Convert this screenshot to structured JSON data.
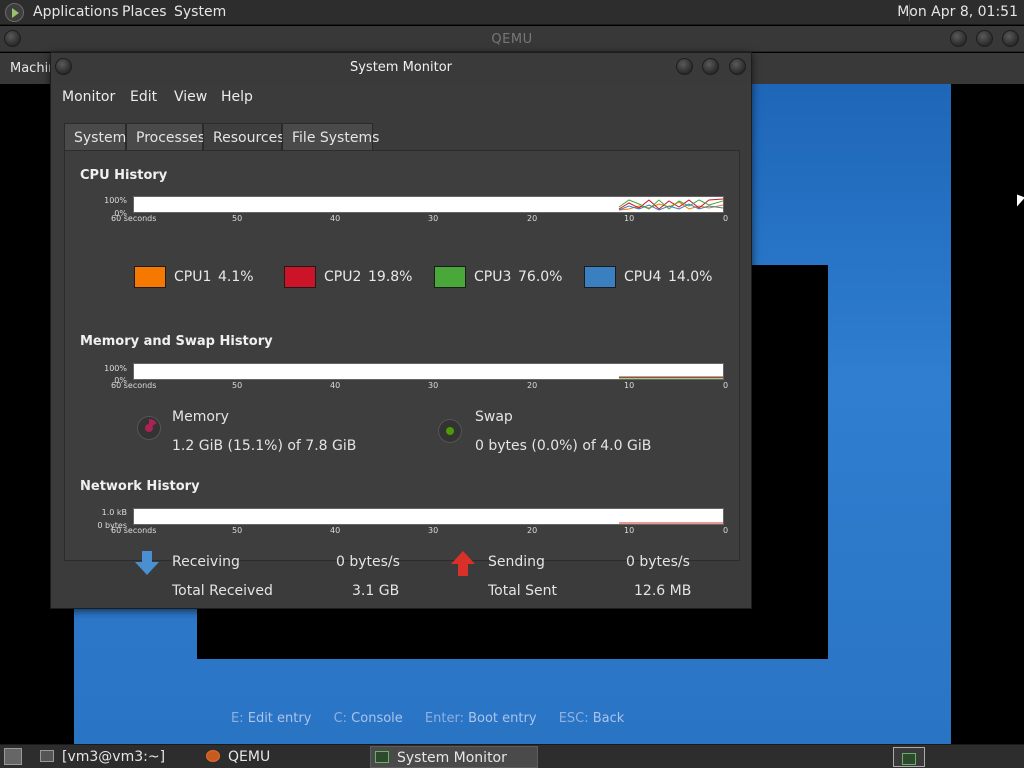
{
  "top_panel": {
    "menus": [
      "Applications",
      "Places",
      "System"
    ],
    "clock": "Mon Apr 8, 01:51"
  },
  "qemu": {
    "title": "QEMU",
    "menu_machine": "Machin"
  },
  "guest": {
    "hints": [
      {
        "key": "E:",
        "label": "Edit entry"
      },
      {
        "key": "C:",
        "label": "Console"
      },
      {
        "key": "Enter:",
        "label": "Boot entry"
      },
      {
        "key": "ESC:",
        "label": "Back"
      }
    ]
  },
  "sysmon": {
    "title": "System Monitor",
    "menus": [
      "Monitor",
      "Edit",
      "View",
      "Help"
    ],
    "tabs": [
      "System",
      "Processes",
      "Resources",
      "File Systems"
    ],
    "active_tab": "Resources",
    "cpu": {
      "title": "CPU History",
      "y_top": "100%",
      "y_bottom": "0%",
      "x_labels": [
        "60 seconds",
        "50",
        "40",
        "30",
        "20",
        "10",
        "0"
      ],
      "cpus": [
        {
          "name": "CPU1",
          "value": "4.1%",
          "color": "#f57900"
        },
        {
          "name": "CPU2",
          "value": "19.8%",
          "color": "#cc1428"
        },
        {
          "name": "CPU3",
          "value": "76.0%",
          "color": "#4aa83a"
        },
        {
          "name": "CPU4",
          "value": "14.0%",
          "color": "#3a7fc0"
        }
      ]
    },
    "memory": {
      "title": "Memory and Swap History",
      "y_top": "100%",
      "y_bottom": "0%",
      "x_labels": [
        "60 seconds",
        "50",
        "40",
        "30",
        "20",
        "10",
        "0"
      ],
      "memory_label": "Memory",
      "memory_value": "1.2 GiB (15.1%) of 7.8 GiB",
      "memory_color": "#ae2156",
      "swap_label": "Swap",
      "swap_value": "0 bytes (0.0%) of 4.0 GiB",
      "swap_color": "#4e9a06"
    },
    "network": {
      "title": "Network History",
      "y_top": "1.0 kB",
      "y_bottom": "0 bytes",
      "x_labels": [
        "60 seconds",
        "50",
        "40",
        "30",
        "20",
        "10",
        "0"
      ],
      "receiving_label": "Receiving",
      "receiving_value": "0 bytes/s",
      "total_received_label": "Total Received",
      "total_received_value": "3.1 GB",
      "sending_label": "Sending",
      "sending_value": "0 bytes/s",
      "total_sent_label": "Total Sent",
      "total_sent_value": "12.6 MB"
    }
  },
  "taskbar": {
    "tasks": [
      "[vm3@vm3:~]",
      "QEMU",
      "System Monitor"
    ]
  }
}
